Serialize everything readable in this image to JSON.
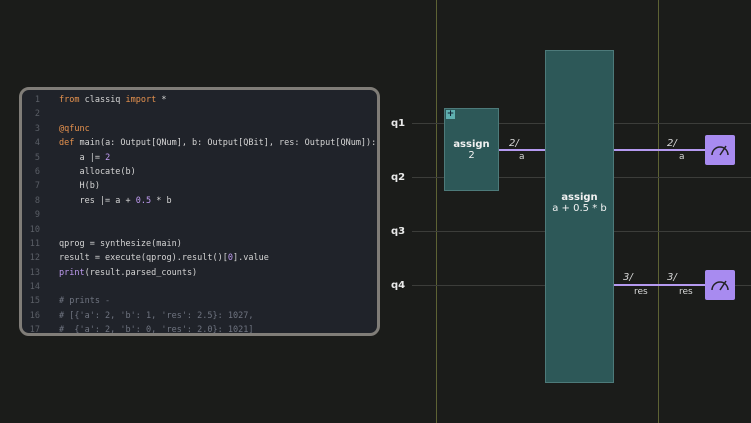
{
  "code_editor": {
    "lines": [
      {
        "n": "1",
        "tokens": [
          {
            "t": "from",
            "c": "kw"
          },
          {
            "t": " classiq "
          },
          {
            "t": "import",
            "c": "kw"
          },
          {
            "t": " *"
          }
        ]
      },
      {
        "n": "2",
        "tokens": []
      },
      {
        "n": "3",
        "tokens": [
          {
            "t": "@qfunc",
            "c": "dec"
          }
        ]
      },
      {
        "n": "4",
        "tokens": [
          {
            "t": "def",
            "c": "kw"
          },
          {
            "t": " main(a: Output[QNum], b: Output[QBit], res: Output[QNum]):"
          }
        ]
      },
      {
        "n": "5",
        "tokens": [
          {
            "t": "    a |= "
          },
          {
            "t": "2",
            "c": "num"
          }
        ]
      },
      {
        "n": "6",
        "tokens": [
          {
            "t": "    allocate(b)"
          }
        ]
      },
      {
        "n": "7",
        "tokens": [
          {
            "t": "    H(b)"
          }
        ]
      },
      {
        "n": "8",
        "tokens": [
          {
            "t": "    res |= a + "
          },
          {
            "t": "0.5",
            "c": "num"
          },
          {
            "t": " * b"
          }
        ]
      },
      {
        "n": "9",
        "tokens": []
      },
      {
        "n": "10",
        "tokens": []
      },
      {
        "n": "11",
        "tokens": [
          {
            "t": "qprog = synthesize(main)"
          }
        ]
      },
      {
        "n": "12",
        "tokens": [
          {
            "t": "result = execute(qprog).result()["
          },
          {
            "t": "0",
            "c": "num"
          },
          {
            "t": "].value"
          }
        ]
      },
      {
        "n": "13",
        "tokens": [
          {
            "t": "print",
            "c": "fn"
          },
          {
            "t": "(result.parsed_counts)"
          }
        ]
      },
      {
        "n": "14",
        "tokens": []
      },
      {
        "n": "15",
        "tokens": [
          {
            "t": "# prints -",
            "c": "cm"
          }
        ]
      },
      {
        "n": "16",
        "tokens": [
          {
            "t": "# [{'a': 2, 'b': 1, 'res': 2.5}: 1027,",
            "c": "cm"
          }
        ]
      },
      {
        "n": "17",
        "tokens": [
          {
            "t": "#  {'a': 2, 'b': 0, 'res': 2.0}: 1021]",
            "c": "cm"
          }
        ]
      }
    ]
  },
  "circuit": {
    "qubits": [
      "q1",
      "q2",
      "q3",
      "q4"
    ],
    "block_assign_a": {
      "title": "assign",
      "subtitle": "2",
      "expand_icon": "+"
    },
    "block_assign_res": {
      "title": "assign",
      "subtitle": "a + 0.5 * b"
    },
    "wire_a_in": {
      "width": "2",
      "name": "a"
    },
    "wire_a_out": {
      "width": "2",
      "name": "a"
    },
    "wire_res_in": {
      "width": "3",
      "name": "res"
    },
    "wire_res_out": {
      "width": "3",
      "name": "res"
    },
    "measure_icon": "meter-icon"
  }
}
